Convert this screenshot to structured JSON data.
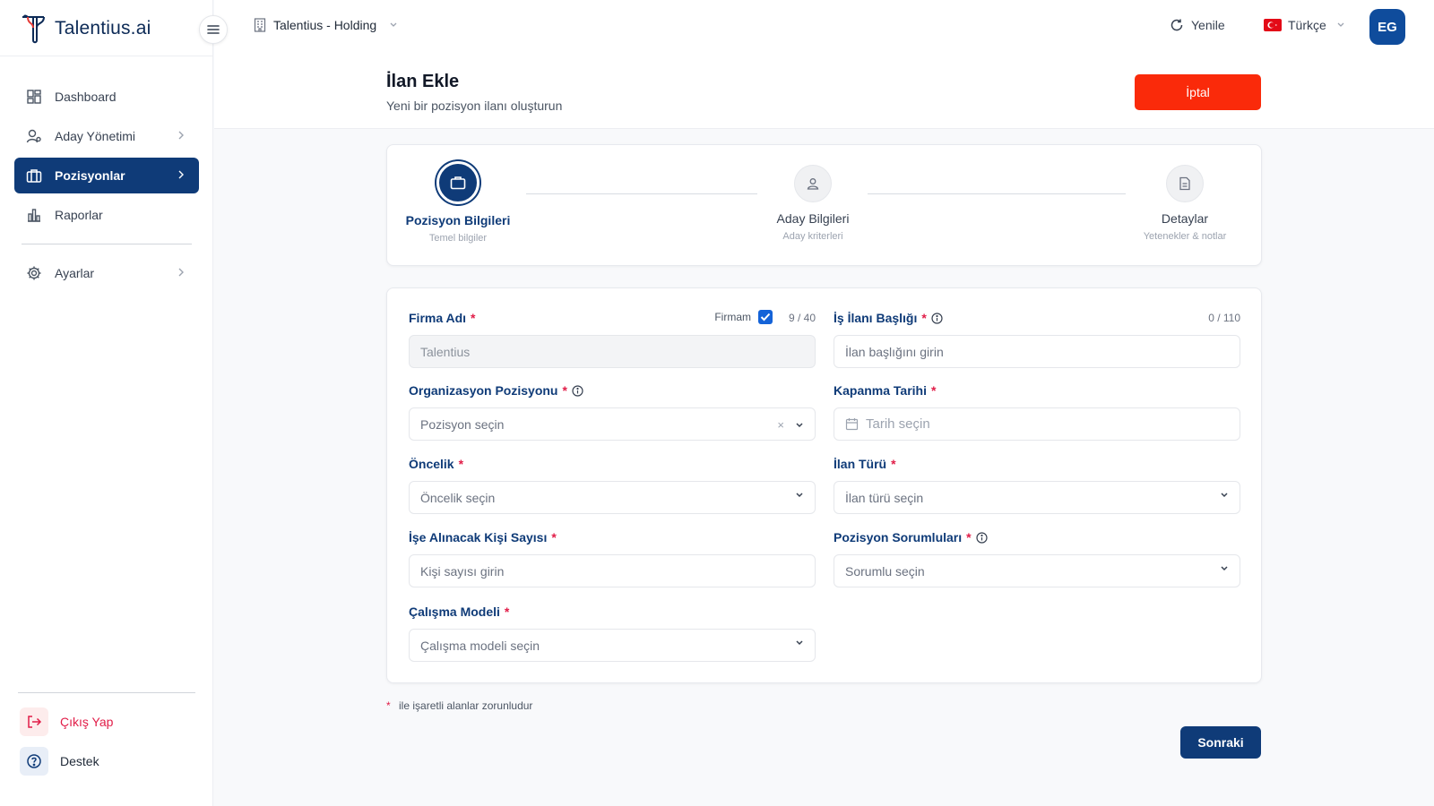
{
  "brand": {
    "name": "Talentius.ai"
  },
  "sidebar": {
    "items": [
      {
        "label": "Dashboard",
        "icon": "grid-icon"
      },
      {
        "label": "Aday Yönetimi",
        "icon": "user-icon"
      },
      {
        "label": "Pozisyonlar",
        "icon": "briefcase-icon",
        "active": true
      },
      {
        "label": "Raporlar",
        "icon": "bar-chart-icon"
      }
    ],
    "settings": {
      "label": "Ayarlar",
      "icon": "gear-icon"
    },
    "logout": {
      "label": "Çıkış Yap",
      "icon": "logout-icon"
    },
    "support": {
      "label": "Destek",
      "icon": "help-icon"
    }
  },
  "topbar": {
    "company": "Talentius - Holding",
    "refresh_label": "Yenile",
    "language": "Türkçe",
    "avatar_initials": "EG"
  },
  "page": {
    "title": "İlan Ekle",
    "subtitle": "Yeni bir pozisyon ilanı oluşturun",
    "cancel_label": "İptal"
  },
  "stepper": {
    "steps": [
      {
        "label": "Pozisyon Bilgileri",
        "hint": "Temel bilgiler",
        "active": true
      },
      {
        "label": "Aday Bilgileri",
        "hint": "Aday kriterleri",
        "active": false
      },
      {
        "label": "Detaylar",
        "hint": "Yetenekler & notlar",
        "active": false
      }
    ]
  },
  "form": {
    "firma": {
      "label": "Firma Adı",
      "checkbox_label": "Firmam",
      "checked": true,
      "counter": "9 / 40",
      "value": "Talentius"
    },
    "ilan_basligi": {
      "label": "İş İlanı Başlığı",
      "counter": "0 / 110",
      "placeholder": "İlan başlığını girin"
    },
    "org_pozisyon": {
      "label": "Organizasyon Pozisyonu",
      "placeholder": "Pozisyon seçin",
      "clear": "×"
    },
    "kapanma": {
      "label": "Kapanma Tarihi",
      "placeholder": "Tarih seçin"
    },
    "oncelik": {
      "label": "Öncelik",
      "placeholder": "Öncelik seçin"
    },
    "ilan_turu": {
      "label": "İlan Türü",
      "placeholder": "İlan türü seçin"
    },
    "kisi_sayisi": {
      "label": "İşe Alınacak Kişi Sayısı",
      "placeholder": "Kişi sayısı girin"
    },
    "sorumlular": {
      "label": "Pozisyon Sorumluları",
      "placeholder": "Sorumlu seçin"
    },
    "calisma_modeli": {
      "label": "Çalışma Modeli",
      "placeholder": "Çalışma modeli seçin"
    },
    "required_mark": "*",
    "required_note": "ile işaretli alanlar zorunludur",
    "next_label": "Sonraki"
  },
  "colors": {
    "primary": "#0f3b78",
    "danger": "#fa2a0a",
    "required": "#e11d48",
    "checkbox": "#1463d8"
  }
}
